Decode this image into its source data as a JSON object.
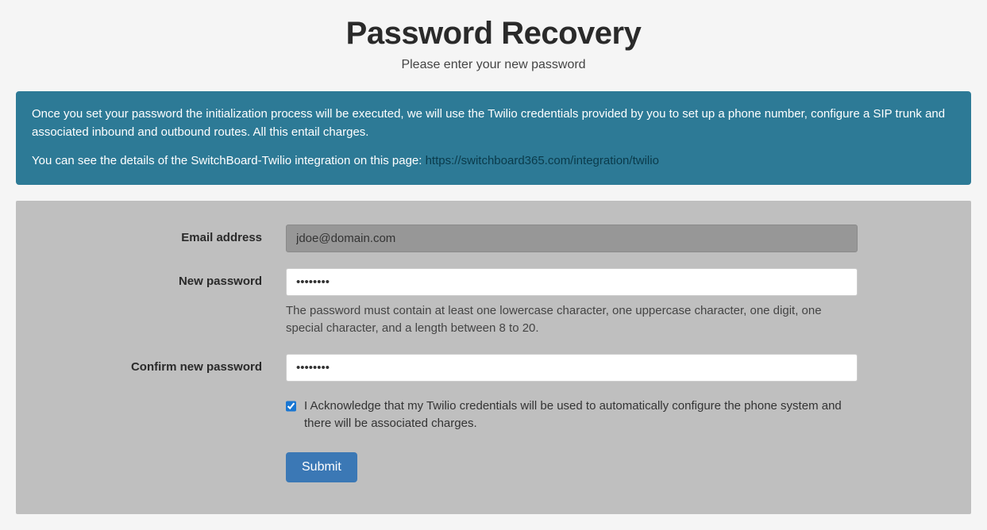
{
  "header": {
    "title": "Password Recovery",
    "subtitle": "Please enter your new password"
  },
  "banner": {
    "paragraph1": "Once you set your password the initialization process will be executed, we will use the Twilio credentials provided by you to set up a phone number, configure a SIP trunk and associated inbound and outbound routes. All this entail charges.",
    "paragraph2_prefix": "You can see the details of the SwitchBoard-Twilio integration on this page: ",
    "link_text": "https://switchboard365.com/integration/twilio"
  },
  "form": {
    "email": {
      "label": "Email address",
      "value": "jdoe@domain.com"
    },
    "new_password": {
      "label": "New password",
      "value": "••••••••",
      "help": "The password must contain at least one lowercase character, one uppercase character, one digit, one special character, and a length between 8 to 20."
    },
    "confirm_password": {
      "label": "Confirm new password",
      "value": "••••••••"
    },
    "acknowledge": {
      "checked": true,
      "label": "I Acknowledge that my Twilio credentials will be used to automatically configure the phone system and there will be associated charges."
    },
    "submit_label": "Submit"
  }
}
